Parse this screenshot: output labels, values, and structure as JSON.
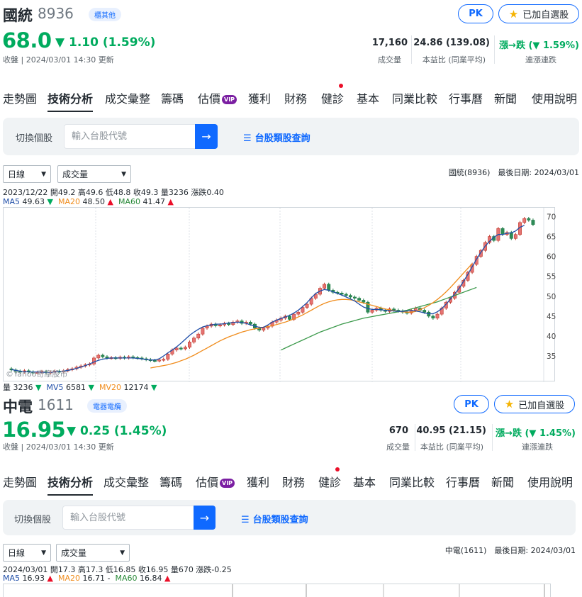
{
  "stocks": [
    {
      "name": "國統",
      "code": "8936",
      "category": "櫃其他",
      "price": "68.0",
      "change": "▼ 1.10 (1.59%)",
      "status": "收盤 | 2024/03/01 14:30 更新",
      "stats": [
        {
          "value": "17,160",
          "label": "成交量"
        },
        {
          "value": "24.86 (139.08)",
          "label": "本益比 (同業平均)"
        },
        {
          "value": "漲→跌 (▼ 1.59%)",
          "label": "連漲連跌"
        }
      ],
      "pk_label": "PK",
      "watch_label": "已加自選股",
      "chart_header": "國統(8936)　最後日期: 2024/03/01",
      "info_line": "2023/12/22 開49.2 高49.6 低48.8 收49.3 量3236 漲跌0.40",
      "ma": [
        {
          "label": "MA5",
          "value": "49.63",
          "dir": "▼"
        },
        {
          "label": "MA20",
          "value": "48.50",
          "dir": "▲"
        },
        {
          "label": "MA60",
          "value": "41.47",
          "dir": "▲"
        }
      ],
      "vol_line": [
        {
          "label": "量",
          "value": "3236",
          "dir": "▼"
        },
        {
          "label": "MV5",
          "value": "6581",
          "dir": "▼"
        },
        {
          "label": "MV20",
          "value": "12174",
          "dir": "▼"
        }
      ],
      "watermark": "©Yahoo奇摩股市"
    },
    {
      "name": "中電",
      "code": "1611",
      "category": "電器電纜",
      "price": "16.95",
      "change": "▼ 0.25 (1.45%)",
      "status": "收盤 | 2024/03/01 14:30 更新",
      "stats": [
        {
          "value": "670",
          "label": "成交量"
        },
        {
          "value": "40.95 (21.15)",
          "label": "本益比 (同業平均)"
        },
        {
          "value": "漲→跌 (▼ 1.45%)",
          "label": "連漲連跌"
        }
      ],
      "pk_label": "PK",
      "watch_label": "已加自選股",
      "chart_header": "中電(1611)　最後日期: 2024/03/01",
      "info_line": "2024/03/01 開17.3 高17.3 低16.85 收16.95 量670 漲跌-0.25",
      "ma": [
        {
          "label": "MA5",
          "value": "16.93",
          "dir": "▲"
        },
        {
          "label": "MA20",
          "value": "16.71",
          "dir": "-"
        },
        {
          "label": "MA60",
          "value": "16.84",
          "dir": "▲"
        }
      ]
    }
  ],
  "tabs": [
    "走勢圖",
    "技術分析",
    "成交彙整",
    "籌碼",
    "估價",
    "獲利",
    "財務",
    "健診",
    "基本",
    "同業比較",
    "行事曆",
    "新聞",
    "使用說明"
  ],
  "vip_label": "VIP",
  "search": {
    "label": "切換個股",
    "placeholder": "輸入台股代號",
    "link": "台股類股查詢"
  },
  "selects": {
    "period": "日線",
    "indicator": "成交量"
  },
  "chart_data": {
    "type": "candlestick",
    "title": "國統(8936)",
    "y_ticks": [
      35,
      40,
      45,
      50,
      55,
      60,
      65,
      70
    ],
    "ylim": [
      29.5,
      71.5
    ],
    "x_range": [
      "2023/07",
      "2024/03/01"
    ],
    "closes": [
      31.5,
      31.2,
      31.0,
      31.3,
      31.0,
      30.8,
      30.9,
      31.1,
      30.8,
      31.0,
      31.2,
      31.0,
      31.3,
      31.6,
      31.8,
      32.2,
      32.5,
      32.8,
      33.0,
      34.5,
      35.2,
      34.8,
      34.5,
      34.6,
      34.4,
      34.7,
      34.5,
      34.8,
      34.6,
      34.5,
      34.3,
      34.1,
      33.9,
      33.8,
      34.0,
      34.2,
      35.5,
      36.5,
      37.0,
      36.8,
      37.2,
      38.5,
      39.5,
      40.5,
      42.0,
      42.5,
      43.0,
      42.6,
      42.8,
      43.2,
      42.9,
      43.5,
      43.8,
      43.2,
      43.5,
      43.0,
      42.0,
      41.5,
      42.0,
      42.5,
      43.5,
      44.0,
      44.5,
      45.0,
      44.2,
      45.5,
      46.0,
      47.2,
      48.0,
      49.5,
      50.5,
      52.0,
      53.0,
      51.5,
      51.0,
      50.8,
      50.5,
      50.2,
      49.8,
      49.5,
      49.0,
      48.5,
      46.0,
      46.5,
      47.0,
      46.5,
      46.2,
      46.8,
      46.5,
      46.3,
      46.0,
      45.8,
      46.5,
      47.0,
      46.5,
      46.0,
      45.0,
      44.5,
      45.5,
      47.0,
      48.5,
      49.5,
      51.0,
      52.5,
      54.0,
      56.0,
      58.0,
      60.0,
      61.5,
      63.5,
      65.0,
      64.0,
      67.0,
      65.5,
      66.0,
      64.5,
      65.5,
      68.5,
      69.5,
      69.1,
      68.0
    ],
    "ma5": [
      31.6,
      31.4,
      31.2,
      31.1,
      31.0,
      31.0,
      31.0,
      30.9,
      30.9,
      30.9,
      31.0,
      31.1,
      31.2,
      31.4,
      31.6,
      31.9,
      32.2,
      32.6,
      33.0,
      33.5,
      33.9,
      34.2,
      34.4,
      34.5,
      34.5,
      34.5,
      34.5,
      34.5,
      34.5,
      34.4,
      34.3,
      34.1,
      34.0,
      34.0,
      34.3,
      35.0,
      35.8,
      36.5,
      37.3,
      38.2,
      39.2,
      40.2,
      41.0,
      41.7,
      42.3,
      42.6,
      42.8,
      43.0,
      43.0,
      43.1,
      43.3,
      43.4,
      43.5,
      43.4,
      43.2,
      42.8,
      42.5,
      42.2,
      42.2,
      42.8,
      43.5,
      44.0,
      44.4,
      44.8,
      45.2,
      45.8,
      46.5,
      47.4,
      48.4,
      49.6,
      50.7,
      51.3,
      51.7,
      51.5,
      51.1,
      50.7,
      50.3,
      49.8,
      49.3,
      48.8,
      48.0,
      47.3,
      46.9,
      46.7,
      46.7,
      46.6,
      46.5,
      46.4,
      46.3,
      46.2,
      46.2,
      46.3,
      46.4,
      46.3,
      46.1,
      45.8,
      45.6,
      45.6,
      46.1,
      46.9,
      48.0,
      49.3,
      50.6,
      52.0,
      53.7,
      55.5,
      57.4,
      59.3,
      61.0,
      62.6,
      63.8,
      64.8,
      65.5,
      65.5,
      65.8,
      65.9,
      66.4,
      67.3,
      67.8
    ],
    "ma20": [
      null,
      null,
      null,
      null,
      null,
      null,
      null,
      null,
      null,
      null,
      null,
      null,
      null,
      null,
      null,
      null,
      null,
      null,
      null,
      null,
      null,
      null,
      null,
      null,
      null,
      null,
      null,
      null,
      null,
      null,
      null,
      null,
      32.0,
      32.2,
      32.4,
      32.6,
      32.8,
      33.1,
      33.4,
      33.8,
      34.2,
      34.7,
      35.2,
      35.8,
      36.4,
      37.0,
      37.6,
      38.2,
      38.8,
      39.3,
      39.8,
      40.2,
      40.6,
      41.0,
      41.3,
      41.6,
      41.8,
      42.0,
      42.2,
      42.4,
      42.6,
      42.9,
      43.2,
      43.5,
      43.9,
      44.3,
      44.8,
      45.3,
      45.9,
      46.5,
      47.1,
      47.7,
      48.2,
      48.6,
      48.9,
      49.1,
      49.2,
      49.2,
      49.1,
      48.9,
      48.6,
      48.3,
      48.0,
      47.7,
      47.4,
      47.1,
      46.8,
      46.6,
      46.4,
      46.2,
      46.1,
      46.0,
      46.0,
      46.2,
      46.6,
      47.1,
      47.7,
      48.4,
      49.2,
      50.1,
      51.1,
      52.2,
      53.4,
      54.6,
      55.8,
      57.0,
      58.2
    ],
    "ma60": [
      null,
      null,
      null,
      null,
      null,
      null,
      null,
      null,
      null,
      null,
      null,
      null,
      null,
      null,
      null,
      null,
      null,
      null,
      null,
      null,
      null,
      null,
      null,
      null,
      null,
      null,
      null,
      null,
      null,
      null,
      null,
      null,
      null,
      null,
      null,
      null,
      null,
      null,
      null,
      null,
      null,
      null,
      null,
      null,
      null,
      null,
      null,
      null,
      null,
      null,
      null,
      null,
      null,
      null,
      null,
      null,
      null,
      null,
      null,
      null,
      null,
      null,
      36.5,
      37.0,
      37.5,
      38.0,
      38.5,
      39.0,
      39.5,
      40.0,
      40.5,
      41.0,
      41.4,
      41.8,
      42.2,
      42.6,
      43.0,
      43.3,
      43.6,
      43.9,
      44.2,
      44.5,
      44.7,
      44.9,
      45.1,
      45.3,
      45.5,
      45.7,
      45.9,
      46.1,
      46.3,
      46.5,
      46.8,
      47.1,
      47.4,
      47.7,
      48.0,
      48.3,
      48.6,
      49.0,
      49.4,
      49.8,
      50.2,
      50.6,
      51.0,
      51.4,
      51.8,
      52.2
    ]
  }
}
